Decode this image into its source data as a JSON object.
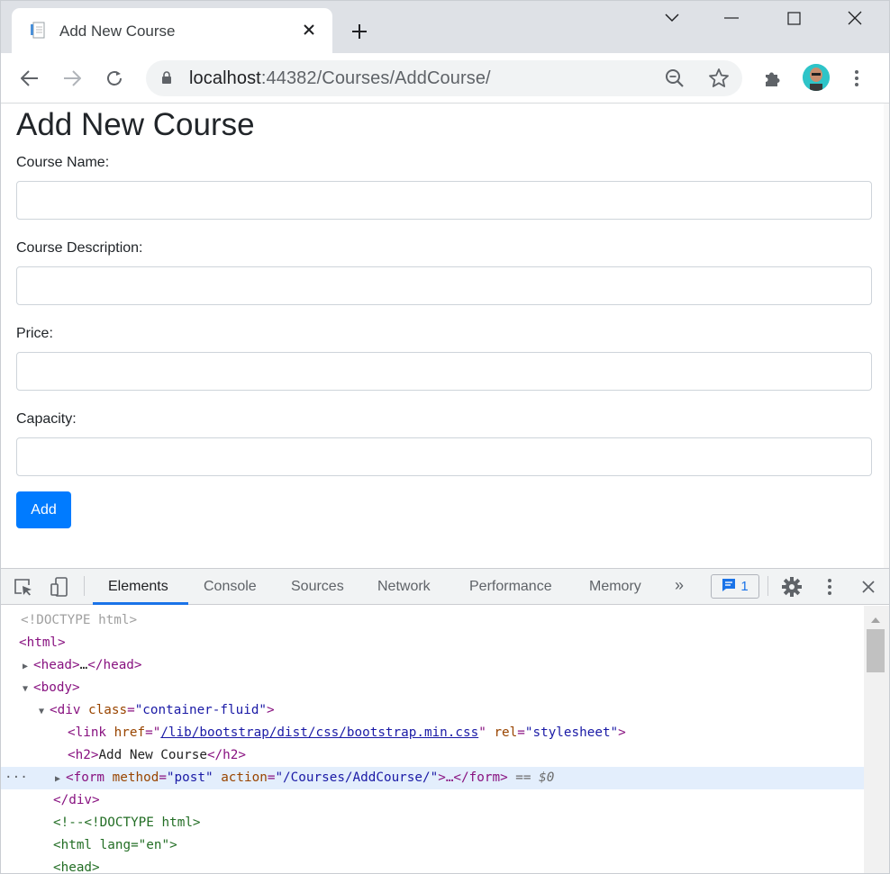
{
  "browser": {
    "tab_title": "Add New Course",
    "url_host": "localhost",
    "url_path": ":44382/Courses/AddCourse/"
  },
  "page": {
    "heading": "Add New Course",
    "fields": [
      {
        "label": "Course Name:",
        "value": ""
      },
      {
        "label": "Course Description:",
        "value": ""
      },
      {
        "label": "Price:",
        "value": ""
      },
      {
        "label": "Capacity:",
        "value": ""
      }
    ],
    "submit_label": "Add"
  },
  "devtools": {
    "tabs": [
      "Elements",
      "Console",
      "Sources",
      "Network",
      "Performance",
      "Memory"
    ],
    "more_label": "»",
    "issues_count": "1",
    "dom": {
      "l1": "<!DOCTYPE html>",
      "l2_tag": "<html>",
      "l3_open": "<head>",
      "l3_dots": "…",
      "l3_close": "</head>",
      "l4_tag": "<body>",
      "l5_open": "<div ",
      "l5_attr": "class",
      "l5_val": "\"container-fluid\"",
      "l5_close": ">",
      "l6_open": "<link ",
      "l6_attr1": "href",
      "l6_href": "/lib/bootstrap/dist/css/bootstrap.min.css",
      "l6_attr2": "rel",
      "l6_val2": "\"stylesheet\"",
      "l6_close": ">",
      "l7_open": "<h2>",
      "l7_text": "Add New Course",
      "l7_close": "</h2>",
      "l8_open": "<form ",
      "l8_attr1": "method",
      "l8_val1": "\"post\"",
      "l8_attr2": "action",
      "l8_val2": "\"/Courses/AddCourse/\"",
      "l8_mid": ">…</form>",
      "l8_eq": " == ",
      "l8_dollar": "$0",
      "l9": "</div>",
      "l10": "<!--<!DOCTYPE html>",
      "l11": "<html lang=\"en\">",
      "l12": "<head>"
    }
  }
}
